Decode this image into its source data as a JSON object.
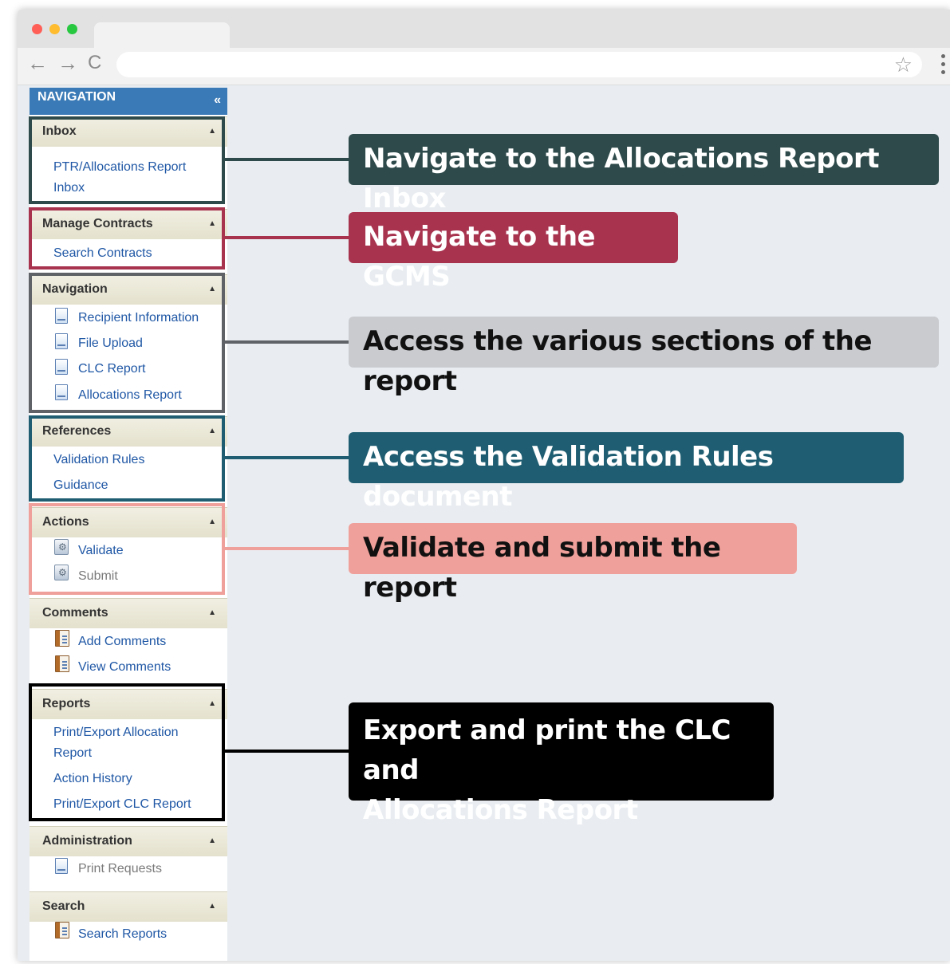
{
  "navigation": {
    "title": "NAVIGATION",
    "collapse_glyph": "«",
    "sections": [
      {
        "title": "Inbox",
        "items": [
          {
            "label": "PTR/Allocations Report Inbox",
            "line1": "PTR/Allocations Report",
            "line2": "Inbox"
          }
        ]
      },
      {
        "title": "Manage Contracts",
        "items": [
          {
            "label": "Search Contracts"
          }
        ]
      },
      {
        "title": "Navigation",
        "items": [
          {
            "label": "Recipient Information",
            "icon": "document-icon"
          },
          {
            "label": "File Upload",
            "icon": "document-icon"
          },
          {
            "label": "CLC Report",
            "icon": "document-icon"
          },
          {
            "label": "Allocations Report",
            "icon": "document-icon"
          }
        ]
      },
      {
        "title": "References",
        "items": [
          {
            "label": "Validation Rules"
          },
          {
            "label": "Guidance"
          }
        ]
      },
      {
        "title": "Actions",
        "items": [
          {
            "label": "Validate",
            "icon": "gear-document-icon"
          },
          {
            "label": "Submit",
            "icon": "gear-document-icon"
          }
        ]
      },
      {
        "title": "Comments",
        "items": [
          {
            "label": "Add Comments",
            "icon": "book-icon"
          },
          {
            "label": "View Comments",
            "icon": "book-icon"
          }
        ]
      },
      {
        "title": "Reports",
        "items": [
          {
            "label": "Print/Export Allocation Report",
            "line1": "Print/Export Allocation",
            "line2": "Report"
          },
          {
            "label": "Action History"
          },
          {
            "label": "Print/Export CLC Report"
          }
        ]
      },
      {
        "title": "Administration",
        "items": [
          {
            "label": "Print Requests",
            "icon": "document-icon"
          }
        ]
      },
      {
        "title": "Search",
        "items": [
          {
            "label": "Search Reports",
            "icon": "book-icon"
          }
        ]
      }
    ]
  },
  "callouts": [
    {
      "text": "Navigate to the Allocations Report Inbox",
      "color": "#2e4a4a"
    },
    {
      "text": "Navigate to the GCMS",
      "color": "#a8334f"
    },
    {
      "text": "Access the various sections of the report",
      "color": "#c9cbcf"
    },
    {
      "text": "Access the Validation Rules document",
      "color": "#1f5e72"
    },
    {
      "text": "Validate and submit the report",
      "color": "#f0a09a"
    },
    {
      "text": "Export and print the CLC and Allocations Report",
      "line1": "Export and print the CLC and",
      "line2": "Allocations Report",
      "color": "#000000"
    }
  ],
  "browser": {
    "back_glyph": "←",
    "forward_glyph": "→",
    "reload_glyph": "C",
    "bookmark_glyph": "☆"
  }
}
